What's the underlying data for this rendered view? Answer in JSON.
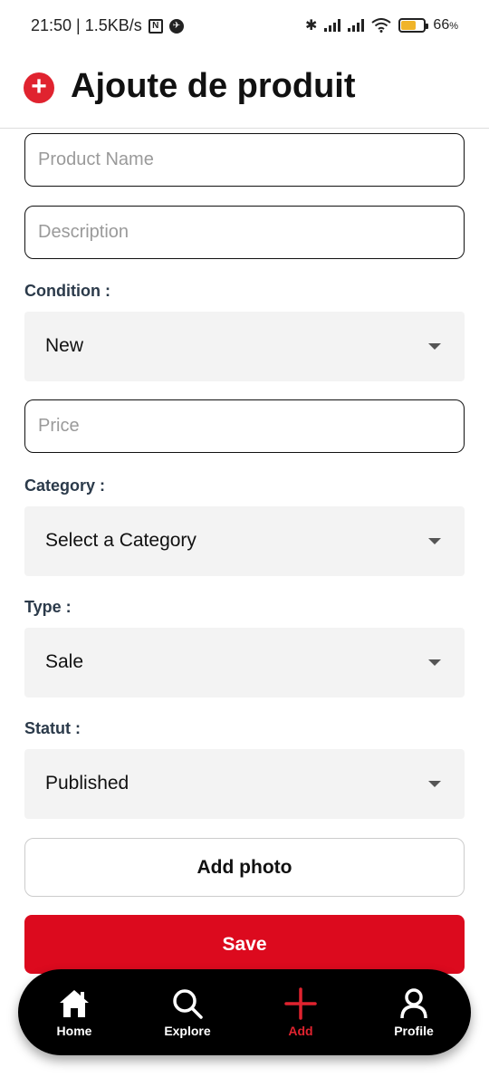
{
  "status_bar": {
    "time_speed": "21:50 | 1.5KB/s",
    "battery_percent": "66",
    "battery_suffix": "%",
    "battery_level": 0.66
  },
  "header": {
    "title": "Ajoute de produit",
    "icon": "add-circle-icon"
  },
  "form": {
    "product_name_placeholder": "Product Name",
    "description_placeholder": "Description",
    "condition_label": "Condition :",
    "condition_value": "New",
    "price_placeholder": "Price",
    "category_label": "Category :",
    "category_value": "Select a Category",
    "type_label": "Type :",
    "type_value": "Sale",
    "statut_label": "Statut :",
    "statut_value": "Published",
    "add_photo_label": "Add photo",
    "save_label": "Save"
  },
  "nav": {
    "items": [
      {
        "label": "Home",
        "icon": "home-icon"
      },
      {
        "label": "Explore",
        "icon": "search-icon"
      },
      {
        "label": "Add",
        "icon": "plus-icon",
        "active": true
      },
      {
        "label": "Profile",
        "icon": "user-icon"
      }
    ]
  },
  "colors": {
    "accent": "#dc0a1e",
    "label": "#2b3a4a",
    "select_bg": "#f3f3f3"
  }
}
